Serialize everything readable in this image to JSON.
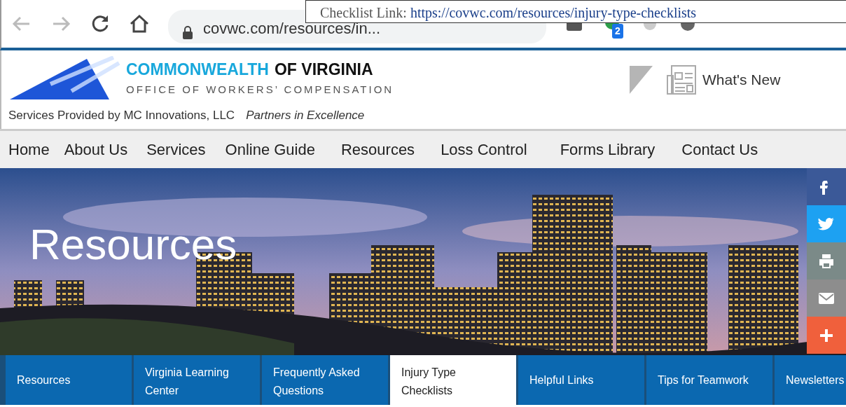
{
  "browser": {
    "url": "covwc.com/resources/in...",
    "extension_badge": "2"
  },
  "tooltip": {
    "label": "Checklist Link:",
    "link": "https://covwc.com/resources/injury-type-checklists"
  },
  "header": {
    "title_first": "COMMONWEALTH",
    "title_second": "OF VIRGINIA",
    "subtitle": "OFFICE OF WORKERS’ COMPENSATION",
    "tagline": "Services Provided by MC Innovations, LLC",
    "slogan": "Partners in Excellence",
    "whats_new": "What's New"
  },
  "nav": [
    "Home",
    "About Us",
    "Services",
    "Online Guide",
    "Resources",
    "Loss Control",
    "Forms Library",
    "Contact Us"
  ],
  "hero": {
    "title": "Resources"
  },
  "tabs": [
    {
      "label": "Resources",
      "selected": false
    },
    {
      "label": "Virginia Learning Center",
      "selected": false
    },
    {
      "label": "Frequently Asked Questions",
      "selected": false
    },
    {
      "label": "Injury Type Checklists",
      "selected": true
    },
    {
      "label": "Helpful Links",
      "selected": false
    },
    {
      "label": "Tips for Teamwork",
      "selected": false
    },
    {
      "label": "Newsletters",
      "selected": false
    }
  ]
}
